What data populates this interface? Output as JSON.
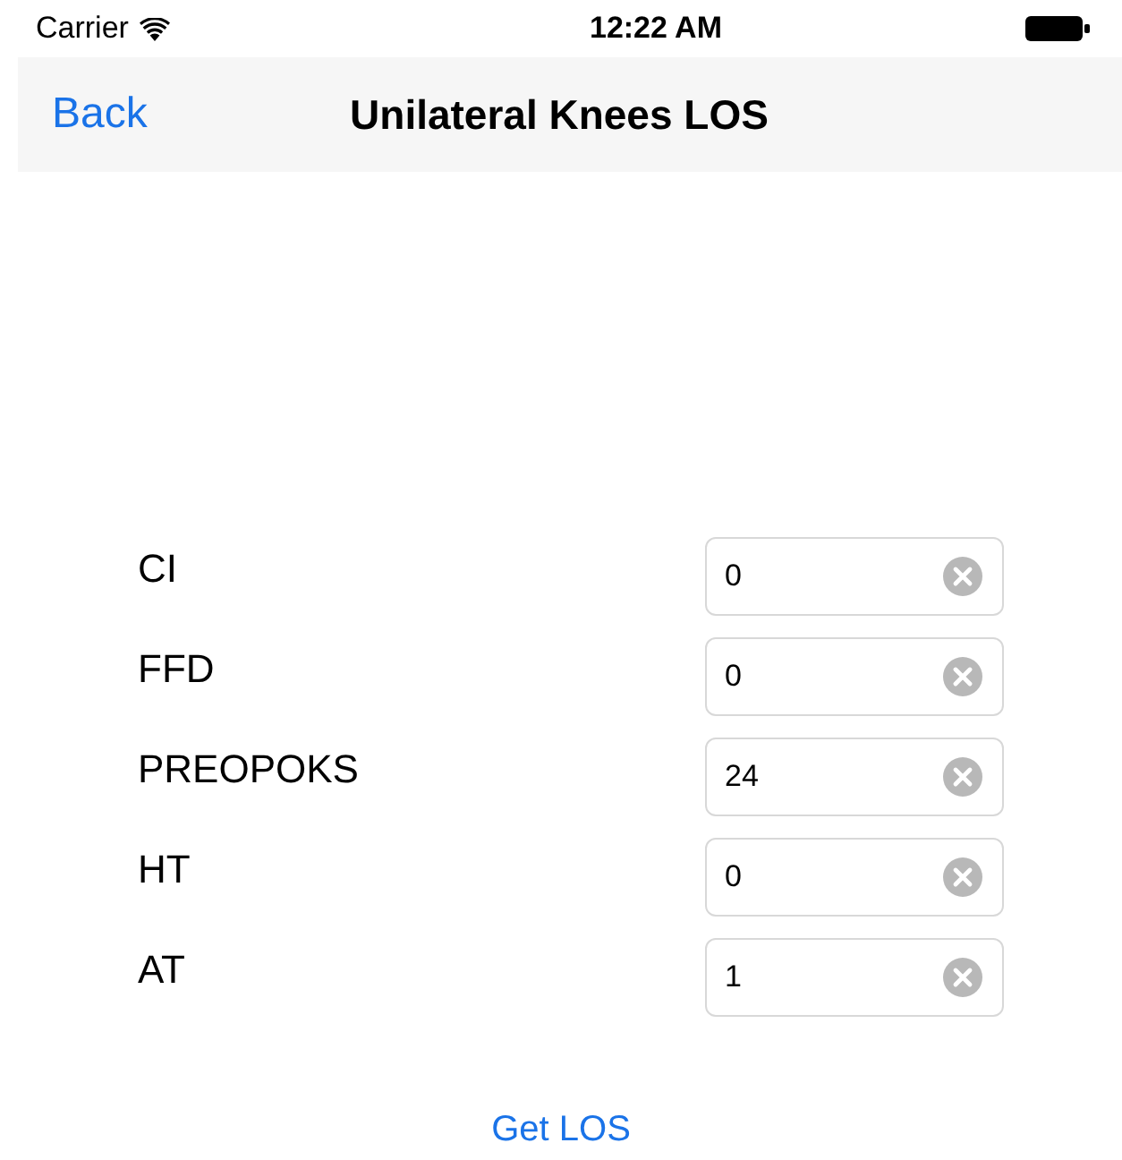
{
  "status_bar": {
    "carrier": "Carrier",
    "time": "12:22 AM"
  },
  "nav_bar": {
    "back": "Back",
    "title": "Unilateral Knees LOS"
  },
  "fields": [
    {
      "label": "CI",
      "value": "0"
    },
    {
      "label": "FFD",
      "value": "0"
    },
    {
      "label": "PREOPOKS",
      "value": "24"
    },
    {
      "label": "HT",
      "value": "0"
    },
    {
      "label": "AT",
      "value": "1"
    }
  ],
  "action": "Get LOS"
}
